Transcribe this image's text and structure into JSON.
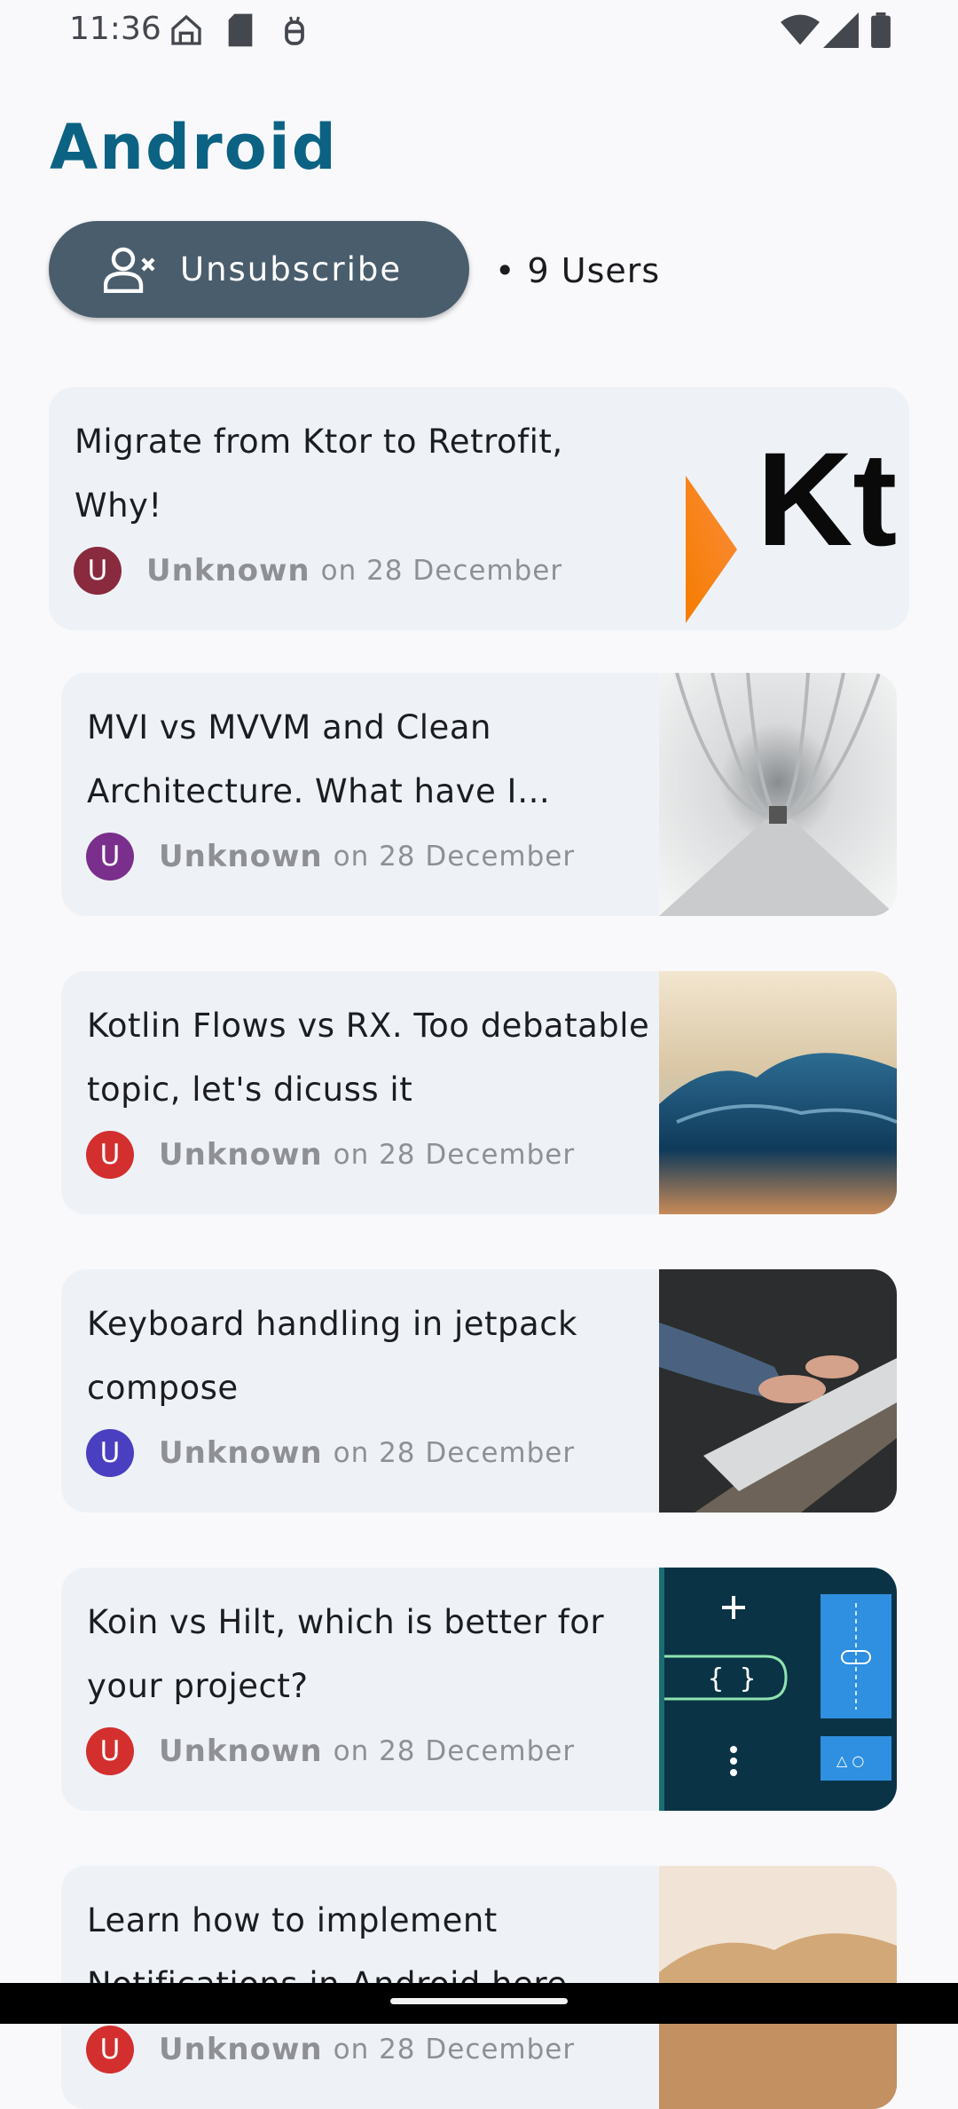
{
  "status_bar": {
    "time": "11:36"
  },
  "page": {
    "title": "Android"
  },
  "actions": {
    "unsubscribe_label": "Unsubscribe",
    "users_count": "• 9 Users"
  },
  "posts": [
    {
      "title": "Migrate from Ktor to Retrofit, Why!",
      "author_initial": "U",
      "author": "Unknown",
      "date": "on 28 December",
      "avatar_color": "#8a2a3e",
      "thumbnail": "ktor-logo-image"
    },
    {
      "title": "MVI vs MVVM and Clean Architecture. What have I learned",
      "author_initial": "U",
      "author": "Unknown",
      "date": "on 28 December",
      "avatar_color": "#7a2f8c",
      "thumbnail": "white-corridor-photo"
    },
    {
      "title": "Kotlin Flows vs RX. Too debatable topic, let's dicuss it",
      "author_initial": "U",
      "author": "Unknown",
      "date": "on 28 December",
      "avatar_color": "#d32f2f",
      "thumbnail": "ocean-wave-photo"
    },
    {
      "title": "Keyboard handling in jetpack compose",
      "author_initial": "U",
      "author": "Unknown",
      "date": "on 28 December",
      "avatar_color": "#4a3fc0",
      "thumbnail": "typing-keyboard-photo"
    },
    {
      "title": "Koin vs Hilt, which is better for your project?",
      "author_initial": "U",
      "author": "Unknown",
      "date": "on 28 December",
      "avatar_color": "#d32f2f",
      "thumbnail": "code-blocks-illustration"
    },
    {
      "title": "Learn how to implement Notifications in Android here",
      "author_initial": "U",
      "author": "Unknown",
      "date": "on 28 December",
      "avatar_color": "#d32f2f",
      "thumbnail": "desert-photo"
    }
  ],
  "icons": {
    "status": [
      "home-icon",
      "sd-card-icon",
      "debug-icon",
      "wifi-icon",
      "signal-icon",
      "battery-icon"
    ],
    "unsubscribe": "person-remove-icon"
  },
  "colors": {
    "title": "#0c6283",
    "button": "#4a5d6c",
    "card": "#eef2f6",
    "background": "#f9f9fc"
  }
}
